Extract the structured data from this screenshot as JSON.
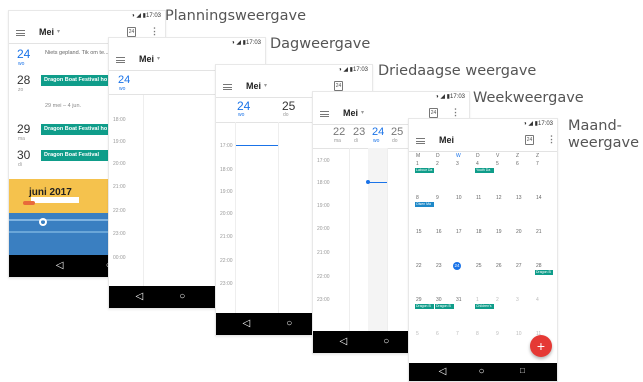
{
  "captions": {
    "planning": "Planningsweergave",
    "dag": "Dagweergave",
    "driedaagse": "Driedaagse weergave",
    "week": "Weekweergave",
    "maand_line1": "Maand-",
    "maand_line2": "weergave"
  },
  "status_time": "◑ ◢ ▮17:03",
  "calendar_icon": "24",
  "more_icon": "⋮",
  "month": "Mei",
  "dropdown": "▾",
  "nav": {
    "back": "◁",
    "home": "○",
    "recent": "□"
  },
  "planning": {
    "day24_num": "24",
    "day24_dow": "wo",
    "day24_text": "Niets gepland. Tik om te...",
    "day28_num": "28",
    "day28_dow": "zo",
    "day28_event": "Dragon Boat Festival ho",
    "range": "29 mei – 4 jun.",
    "day29_num": "29",
    "day29_dow": "ma",
    "day29_event": "Dragon Boat Festival ho",
    "day30_num": "30",
    "day30_dow": "di",
    "day30_event": "Dragon Boat Festival",
    "banner": "juni 2017"
  },
  "times_dag": [
    "18:00",
    "19:00",
    "20:00",
    "21:00",
    "22:00",
    "23:00",
    "00:00"
  ],
  "times_drie": [
    "17:00",
    "18:00",
    "19:00",
    "20:00",
    "21:00",
    "22:00",
    "23:00"
  ],
  "times_week": [
    "17:00",
    "18:00",
    "19:00",
    "20:00",
    "21:00",
    "22:00",
    "23:00"
  ],
  "dag": {
    "num": "24",
    "dow": "wo"
  },
  "drie": {
    "d1_num": "24",
    "d1_dow": "wo",
    "d2_num": "25",
    "d2_dow": "do"
  },
  "week": {
    "d1_num": "22",
    "d1_dow": "ma",
    "d2_num": "23",
    "d2_dow": "di",
    "d3_num": "24",
    "d3_dow": "wo",
    "d4_num": "25",
    "d4_dow": "do"
  },
  "maand": {
    "weekdays": [
      "M",
      "D",
      "W",
      "D",
      "V",
      "Z",
      "Z"
    ],
    "rows": [
      [
        "1",
        "2",
        "3",
        "4",
        "5",
        "6",
        "7"
      ],
      [
        "8",
        "9",
        "10",
        "11",
        "12",
        "13",
        "14"
      ],
      [
        "15",
        "16",
        "17",
        "18",
        "19",
        "20",
        "21"
      ],
      [
        "22",
        "23",
        "24",
        "25",
        "26",
        "27",
        "28"
      ],
      [
        "29",
        "30",
        "31",
        "1",
        "2",
        "3",
        "4"
      ],
      [
        "5",
        "6",
        "7",
        "8",
        "9",
        "10",
        "11"
      ]
    ],
    "events": {
      "labour": "Labour Da",
      "youth": "Youth Da",
      "olsen": "Olsen Ma",
      "dragon_r4": "Dragon B",
      "dragon_r5a": "Dragon B",
      "dragon_r5b": "Dragon B",
      "children": "Children's"
    },
    "fab": "+"
  }
}
